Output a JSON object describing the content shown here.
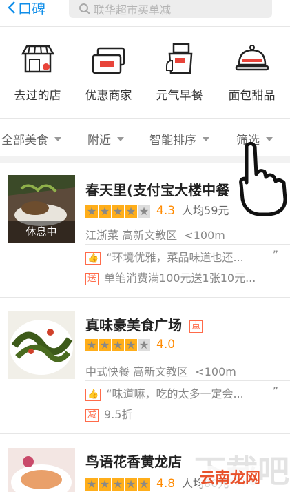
{
  "header": {
    "back_label": "口碑",
    "search_placeholder": "联华超市买单减"
  },
  "categories": [
    {
      "label": "去过的店",
      "icon": "store-icon"
    },
    {
      "label": "优惠商家",
      "icon": "coupon-icon"
    },
    {
      "label": "元气早餐",
      "icon": "breakfast-icon"
    },
    {
      "label": "面包甜品",
      "icon": "dessert-cloche-icon"
    }
  ],
  "filters": [
    "全部美食",
    "附近",
    "智能排序",
    "筛选"
  ],
  "shops": [
    {
      "name": "春天里(支付宝大楼中餐",
      "rating": 4.3,
      "score": "4.3",
      "avg": "人均59元",
      "cuisine": "江浙菜",
      "area": "高新文教区",
      "distance": "<100m",
      "review": "“环境优雅，菜品味道也还...",
      "review_end": "”",
      "promo_tag": "送",
      "promo": "单笔消费满100元送1张10元...",
      "status": "休息中"
    },
    {
      "name": "真味豪美食广场",
      "badge": "点",
      "rating": 4.0,
      "score": "4.0",
      "cuisine": "中式快餐",
      "area": "高新文教区",
      "distance": "<100m",
      "review": "“味道嘛，吃的太多一定会...",
      "review_end": "”",
      "promo_tag": "减",
      "promo": "9.5折"
    },
    {
      "name": "鸟语花香黄龙店",
      "rating": 4.8,
      "score": "4.8",
      "avg": "人均80元"
    }
  ],
  "watermark": {
    "big": "下载吧",
    "small": "云南龙网"
  },
  "colors": {
    "accent": "#108ee9",
    "star": "#ffae1a",
    "score": "#ff8a00",
    "promo": "#ff6b4a"
  }
}
